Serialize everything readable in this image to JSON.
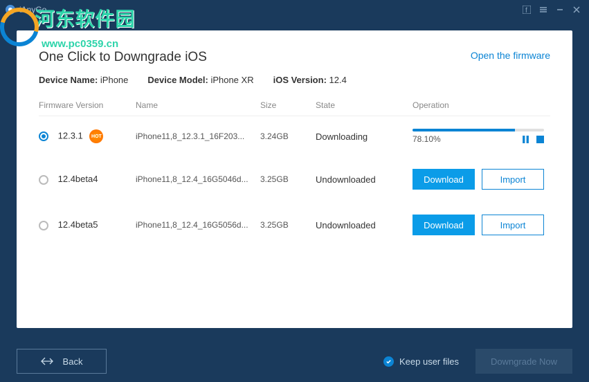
{
  "app": {
    "name": "iAnyGo"
  },
  "watermark": {
    "line1": "河东软件园",
    "line2": "www.pc0359.cn"
  },
  "header": {
    "title": "One Click to Downgrade iOS",
    "open_firmware": "Open the firmware"
  },
  "device": {
    "name_label": "Device Name:",
    "name_value": "iPhone",
    "model_label": "Device Model:",
    "model_value": "iPhone XR",
    "ios_label": "iOS Version:",
    "ios_value": "12.4"
  },
  "columns": {
    "version": "Firmware Version",
    "name": "Name",
    "size": "Size",
    "state": "State",
    "operation": "Operation"
  },
  "rows": [
    {
      "selected": true,
      "version": "12.3.1",
      "hot": true,
      "name": "iPhone11,8_12.3.1_16F203...",
      "size": "3.24GB",
      "state": "Downloading",
      "progress": "78.10%",
      "progress_pct": 78.1
    },
    {
      "selected": false,
      "version": "12.4beta4",
      "hot": false,
      "name": "iPhone11,8_12.4_16G5046d...",
      "size": "3.25GB",
      "state": "Undownloaded"
    },
    {
      "selected": false,
      "version": "12.4beta5",
      "hot": false,
      "name": "iPhone11,8_12.4_16G5056d...",
      "size": "3.25GB",
      "state": "Undownloaded"
    }
  ],
  "buttons": {
    "download": "Download",
    "import": "Import",
    "back": "Back",
    "keep_files": "Keep user files",
    "downgrade": "Downgrade Now"
  },
  "badges": {
    "hot": "HOT"
  }
}
